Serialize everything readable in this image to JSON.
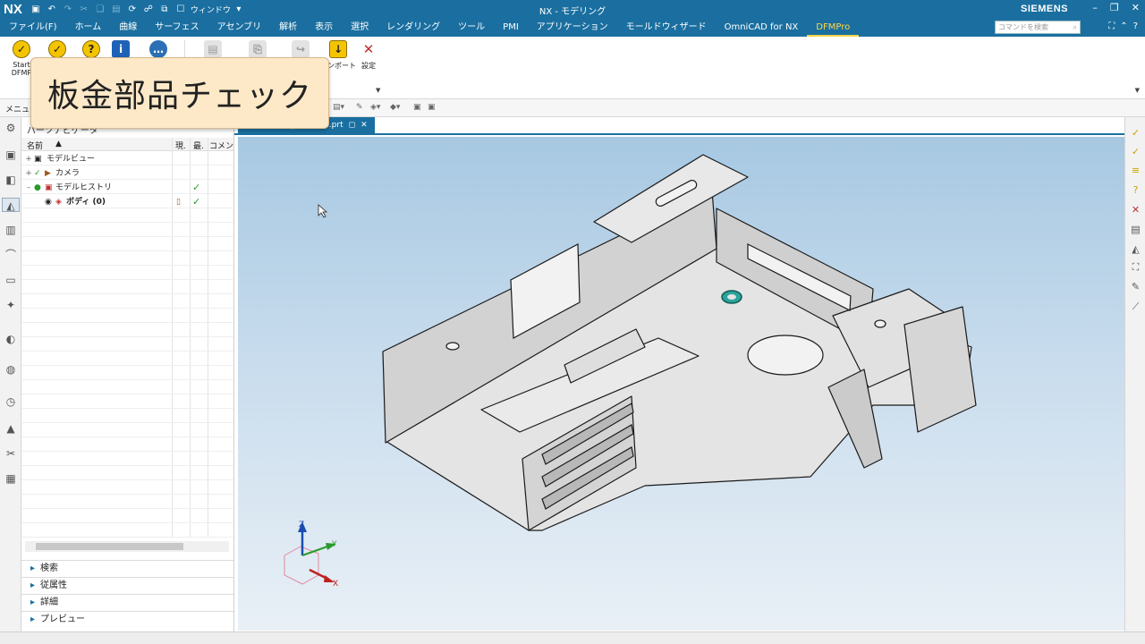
{
  "titlebar": {
    "logo": "NX",
    "window_menu": "ウィンドウ",
    "title": "NX - モデリング",
    "brand": "SIEMENS",
    "minimize": "–",
    "restore": "❐",
    "close": "✕"
  },
  "menubar": {
    "items": [
      {
        "label": "ファイル(F)"
      },
      {
        "label": "ホーム"
      },
      {
        "label": "曲線"
      },
      {
        "label": "サーフェス"
      },
      {
        "label": "アセンブリ"
      },
      {
        "label": "解析"
      },
      {
        "label": "表示"
      },
      {
        "label": "選択"
      },
      {
        "label": "レンダリング"
      },
      {
        "label": "ツール"
      },
      {
        "label": "PMI"
      },
      {
        "label": "アプリケーション"
      },
      {
        "label": "モールドウィザード"
      },
      {
        "label": "OmniCAD for NX"
      },
      {
        "label": "DFMPro"
      }
    ],
    "active_index": 14,
    "search_placeholder": "コマンドを検索"
  },
  "ribbon": {
    "start_label_line1": "Start",
    "start_label_line2": "DFMP",
    "import_label": "インポート",
    "settings_label": "設定"
  },
  "toolbar2": {
    "menu_label": "メニュー"
  },
  "navigator": {
    "title": "パーツナビゲータ",
    "columns": {
      "name": "名前",
      "current": "現.",
      "latest": "最.",
      "comment": "コメン"
    },
    "rows": [
      {
        "expander": "+",
        "label": "モデルビュー",
        "check": ""
      },
      {
        "expander": "+",
        "label": "カメラ",
        "check": ""
      },
      {
        "expander": "–",
        "label": "モデルヒストリ",
        "check": "✓"
      },
      {
        "expander": "",
        "label": "ボディ (0)",
        "check": "✓"
      }
    ],
    "sections": [
      "検索",
      "従属性",
      "詳細",
      "プレビュー"
    ]
  },
  "tab": {
    "label": "sheetmetal_sample1.prt"
  },
  "callout": {
    "text": "板金部品チェック"
  },
  "triad": {
    "x": "X",
    "y": "Y",
    "z": "Z"
  },
  "colors": {
    "nx_blue": "#1a6fa0",
    "active_tab": "#ffd54a",
    "callout_bg": "#fde9c8",
    "part_gray": "#d9d9d9"
  }
}
